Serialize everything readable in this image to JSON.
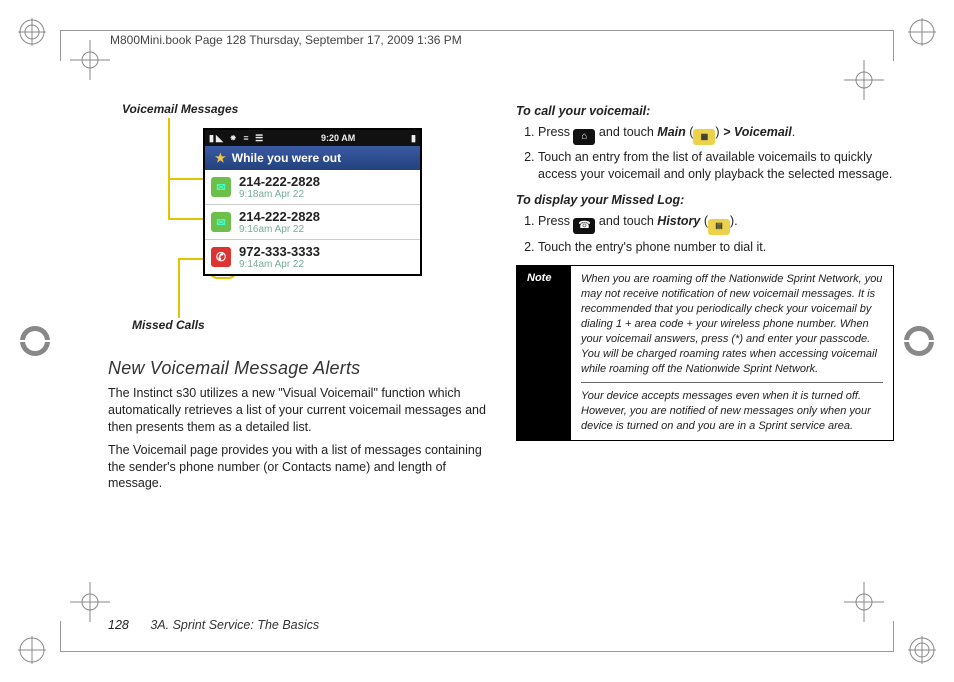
{
  "header": "M800Mini.book  Page 128  Thursday, September 17, 2009  1:36 PM",
  "figure": {
    "label_top": "Voicemail Messages",
    "label_bottom": "Missed Calls",
    "status_time": "9:20 AM",
    "status_left": "▮◣  ⁕  ≡  ☰",
    "banner": "While you were out",
    "rows": [
      {
        "type": "vm",
        "number": "214-222-2828",
        "time": "9:18am Apr 22"
      },
      {
        "type": "vm",
        "number": "214-222-2828",
        "time": "9:16am Apr 22"
      },
      {
        "type": "mc",
        "number": "972-333-3333",
        "time": "9:14am Apr 22"
      }
    ]
  },
  "left": {
    "heading": "New Voicemail Message Alerts",
    "p1": "The Instinct s30 utilizes a new \"Visual Voicemail\" function which automatically retrieves a list of your current voicemail messages and then presents them as a detailed list.",
    "p2": "The Voicemail page provides you with a list of messages containing the sender's phone number (or Contacts name) and length of message."
  },
  "right": {
    "sub1": "To call your voicemail:",
    "s1_press": "Press ",
    "s1_touch": " and touch ",
    "s1_main": "Main",
    "s1_paren_open": " (",
    "s1_paren_close": ") ",
    "s1_gt": ">",
    "s1_vm": " Voicemail",
    "s1_period": ".",
    "s2": "Touch an entry from the list of available voicemails to quickly access your voicemail and only playback the selected message.",
    "sub2": "To display your Missed Log:",
    "m1_press": "Press ",
    "m1_touch": " and touch ",
    "m1_hist": "History",
    "m1_paren_open": " (",
    "m1_paren_close": ").",
    "m2": "Touch the entry's phone number to dial it.",
    "note_label": "Note",
    "note1": "When you are roaming off the Nationwide Sprint Network, you may not receive notification of new voicemail messages. It is recommended that you periodically check your voicemail by dialing 1 + area code + your wireless phone number. When your voicemail answers, press (*) and enter your passcode. You will be charged roaming rates when accessing voicemail while roaming off the Nationwide Sprint Network.",
    "note2": "Your device accepts messages even when it is turned off. However, you are notified of new messages only when your device is turned on and you are in a Sprint service area."
  },
  "footer": {
    "page": "128",
    "chapter": "3A. Sprint Service: The Basics"
  }
}
